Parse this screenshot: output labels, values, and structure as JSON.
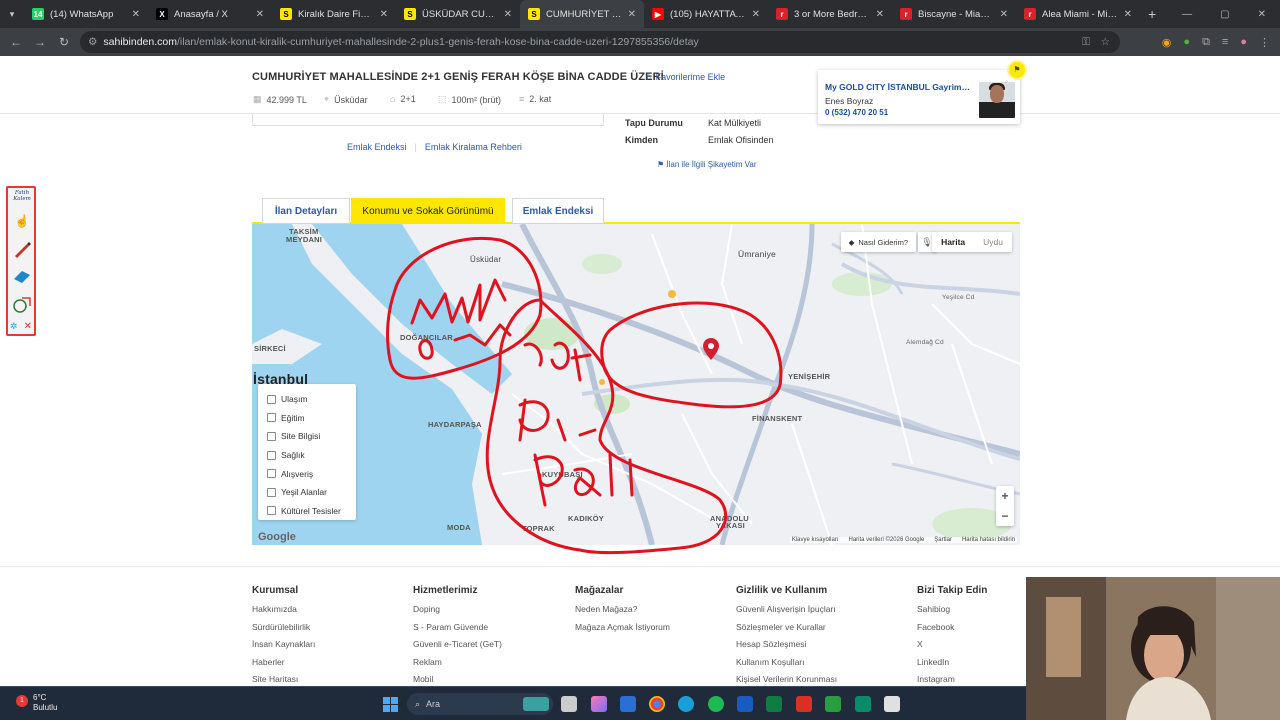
{
  "browser": {
    "tabs": [
      {
        "label": "(14) WhatsApp",
        "icon": "whatsapp-icon",
        "color": "#25d366",
        "glyph": "14"
      },
      {
        "label": "Anasayfa / X",
        "icon": "x-icon",
        "color": "#000000",
        "glyph": "X"
      },
      {
        "label": "Kiralık Daire Fiyatları",
        "icon": "sahibinden-icon",
        "color": "#ffe600",
        "glyph": "S"
      },
      {
        "label": "ÜSKÜDAR CUMHURİYE",
        "icon": "sahibinden-icon",
        "color": "#ffe600",
        "glyph": "S"
      },
      {
        "label": "CUMHURİYET MAHALLE",
        "icon": "sahibinden-icon",
        "color": "#ffe600",
        "glyph": "S",
        "active": true
      },
      {
        "label": "(105) HAYATTAYIM VL",
        "icon": "youtube-icon",
        "color": "#ff0000",
        "glyph": "▶"
      },
      {
        "label": "3 or More Bedroom Co",
        "icon": "realtor-icon",
        "color": "#d92228",
        "glyph": "r"
      },
      {
        "label": "Biscayne - Miami, FL",
        "icon": "realtor-icon",
        "color": "#d92228",
        "glyph": "r"
      },
      {
        "label": "Alea Miami - Miami, Fl",
        "icon": "realtor-icon",
        "color": "#d92228",
        "glyph": "r"
      }
    ],
    "url_host": "sahibinden.com",
    "url_path": "/ilan/emlak-konut-kiralik-cumhuriyet-mahallesinde-2-plus1-genis-ferah-kose-bina-cadde-uzeri-1297855356/detay"
  },
  "listing": {
    "title": "CUMHURİYET MAHALLESİNDE 2+1 GENİŞ FERAH KÖŞE BİNA CADDE ÜZERİ",
    "favorite_label": "Favorilerime Ekle",
    "price": "42.999 TL",
    "district": "Üsküdar",
    "rooms": "2+1",
    "area": "100m² (brüt)",
    "floor": "2. kat"
  },
  "agent": {
    "office": "My GOLD CITY İSTANBUL Gayrimenkul",
    "name": "Enes Boyraz",
    "phone": "0 (532) 470 20 51"
  },
  "info": [
    {
      "key": "Tapu Durumu",
      "value": "Kat Mülkiyetli"
    },
    {
      "key": "Kimden",
      "value": "Emlak Ofisinden"
    }
  ],
  "links": {
    "emlak_endeksi": "Emlak Endeksi",
    "kiralama_rehberi": "Emlak Kiralama Rehberi",
    "complaint": "İlan ile İlgili Şikayetim Var"
  },
  "detail_tabs": [
    {
      "label": "İlan Detayları",
      "active": false
    },
    {
      "label": "Konumu ve Sokak Görünümü",
      "active": true
    },
    {
      "label": "Emlak Endeksi",
      "active": false
    }
  ],
  "map": {
    "route_label": "Nasıl Giderim?",
    "type_map": "Harita",
    "type_sat": "Uydu",
    "filters": [
      "Ulaşım",
      "Eğitim",
      "Site Bilgisi",
      "Sağlık",
      "Alışveriş",
      "Yeşil Alanlar",
      "Kültürel Tesisler"
    ],
    "google": "Google",
    "attribution": [
      "Klavye kısayolları",
      "Harita verileri ©2026 Google",
      "Şartlar",
      "Harita hatası bildirin"
    ],
    "labels": {
      "taksim": "TAKSİM",
      "meydani": "MEYDANI",
      "sirkeci": "SİRKECİ",
      "istanbul": "İstanbul",
      "uskudar": "Üsküdar",
      "umraniye": "Ümraniye",
      "yenisehir": "YENİŞEHİR",
      "finanskent": "FİNANSKENT",
      "haydarpasa": "HAYDARPAŞA",
      "kuyubasi": "KUYUBAŞI",
      "kadikoy": "KADIKÖY",
      "moda": "MODA",
      "toprak": "TOPRAK",
      "anadolu": "ANADOLU",
      "yakasi": "YAKASI",
      "dogancilar": "DOĞANCILAR",
      "cumhuriyet": "CUMHURİYET",
      "alemdag": "Alemdağ Cd",
      "yesilce": "Yeşilce Cd"
    }
  },
  "footer": [
    {
      "heading": "Kurumsal",
      "items": [
        "Hakkımızda",
        "Sürdürülebilirlik",
        "İnsan Kaynakları",
        "Haberler",
        "Site Haritası"
      ]
    },
    {
      "heading": "Hizmetlerimiz",
      "items": [
        "Doping",
        "S - Param Güvende",
        "Güvenli e-Ticaret (GeT)",
        "Reklam",
        "Mobil"
      ]
    },
    {
      "heading": "Mağazalar",
      "items": [
        "Neden Mağaza?",
        "Mağaza Açmak İstiyorum"
      ]
    },
    {
      "heading": "Gizlilik ve Kullanım",
      "items": [
        "Güvenli Alışverişin İpuçları",
        "Sözleşmeler ve Kurallar",
        "Hesap Sözleşmesi",
        "Kullanım Koşulları",
        "Kişisel Verilerin Korunması"
      ]
    },
    {
      "heading": "Bizi Takip Edin",
      "items": [
        "Sahibiog",
        "Facebook",
        "X",
        "LinkedIn",
        "Instagram"
      ]
    }
  ],
  "pen_tool": {
    "brand": "Fatih Kalem"
  },
  "annotations": {
    "text1": "pahali",
    "text2": "köşe",
    "text3": "pahali",
    "ink_color": "#e0121e"
  },
  "taskbar": {
    "temp": "6°C",
    "condition": "Bulutlu",
    "search_placeholder": "Ara",
    "notification_count": "1"
  }
}
